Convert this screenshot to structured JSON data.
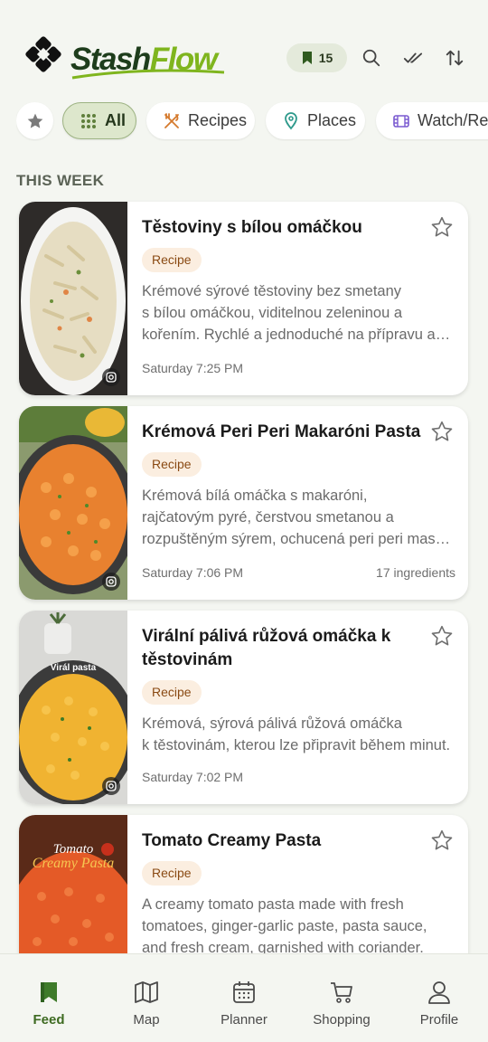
{
  "app": {
    "brand_part1": "Stash",
    "brand_part2": "Flow",
    "saved_count": "15"
  },
  "filters": [
    {
      "label": "All",
      "icon": "grid-icon",
      "active": true
    },
    {
      "label": "Recipes",
      "icon": "utensils-icon"
    },
    {
      "label": "Places",
      "icon": "map-pin-icon"
    },
    {
      "label": "Watch/Read",
      "icon": "film-icon"
    }
  ],
  "section_title": "THIS WEEK",
  "cards": [
    {
      "title": "Těstoviny s bílou omáčkou",
      "tag": "Recipe",
      "desc": [
        "Krémové sýrové těstoviny bez smetany",
        "s bílou omáčkou, viditelnou zeleninou a",
        "kořením. Rychlé a jednoduché na přípravu a chutné."
      ],
      "time": "Saturday 7:25 PM",
      "extra": ""
    },
    {
      "title": "Krémová Peri Peri Makaróni Pasta",
      "tag": "Recipe",
      "desc": [
        "Krémová bílá omáčka s makaróni,",
        "rajčatovým pyré, čerstvou smetanou a",
        "rozpuštěným sýrem, ochucená peri peri masalou."
      ],
      "time": "Saturday 7:06 PM",
      "extra": "17 ingredients"
    },
    {
      "title_line1": "Virální pálivá růžová omáčka k",
      "title_line2": "těstovinám",
      "tag": "Recipe",
      "desc": [
        "Krémová, sýrová pálivá růžová omáčka",
        "k těstovinám, kterou lze připravit během minut."
      ],
      "time": "Saturday 7:02 PM",
      "extra": "",
      "thumb_caption": "Virál pasta"
    },
    {
      "title": "Tomato Creamy Pasta",
      "tag": "Recipe",
      "desc": [
        "A creamy tomato pasta made with fresh",
        "tomatoes, ginger-garlic paste, pasta sauce,",
        "and fresh cream, garnished with coriander."
      ],
      "thumb_line1": "Tomato",
      "thumb_line2": "Creamy Pasta"
    }
  ],
  "nav": [
    {
      "label": "Feed",
      "icon": "bookmark-icon",
      "active": true
    },
    {
      "label": "Map",
      "icon": "map-icon"
    },
    {
      "label": "Planner",
      "icon": "calendar-icon"
    },
    {
      "label": "Shopping",
      "icon": "cart-icon"
    },
    {
      "label": "Profile",
      "icon": "person-icon"
    }
  ],
  "colors": {
    "accent": "#3e6b22",
    "brand_dark": "#1e3d1c",
    "brand_light": "#7fb51e",
    "tag_bg": "#fbeee0",
    "tag_text": "#8a4a13"
  }
}
